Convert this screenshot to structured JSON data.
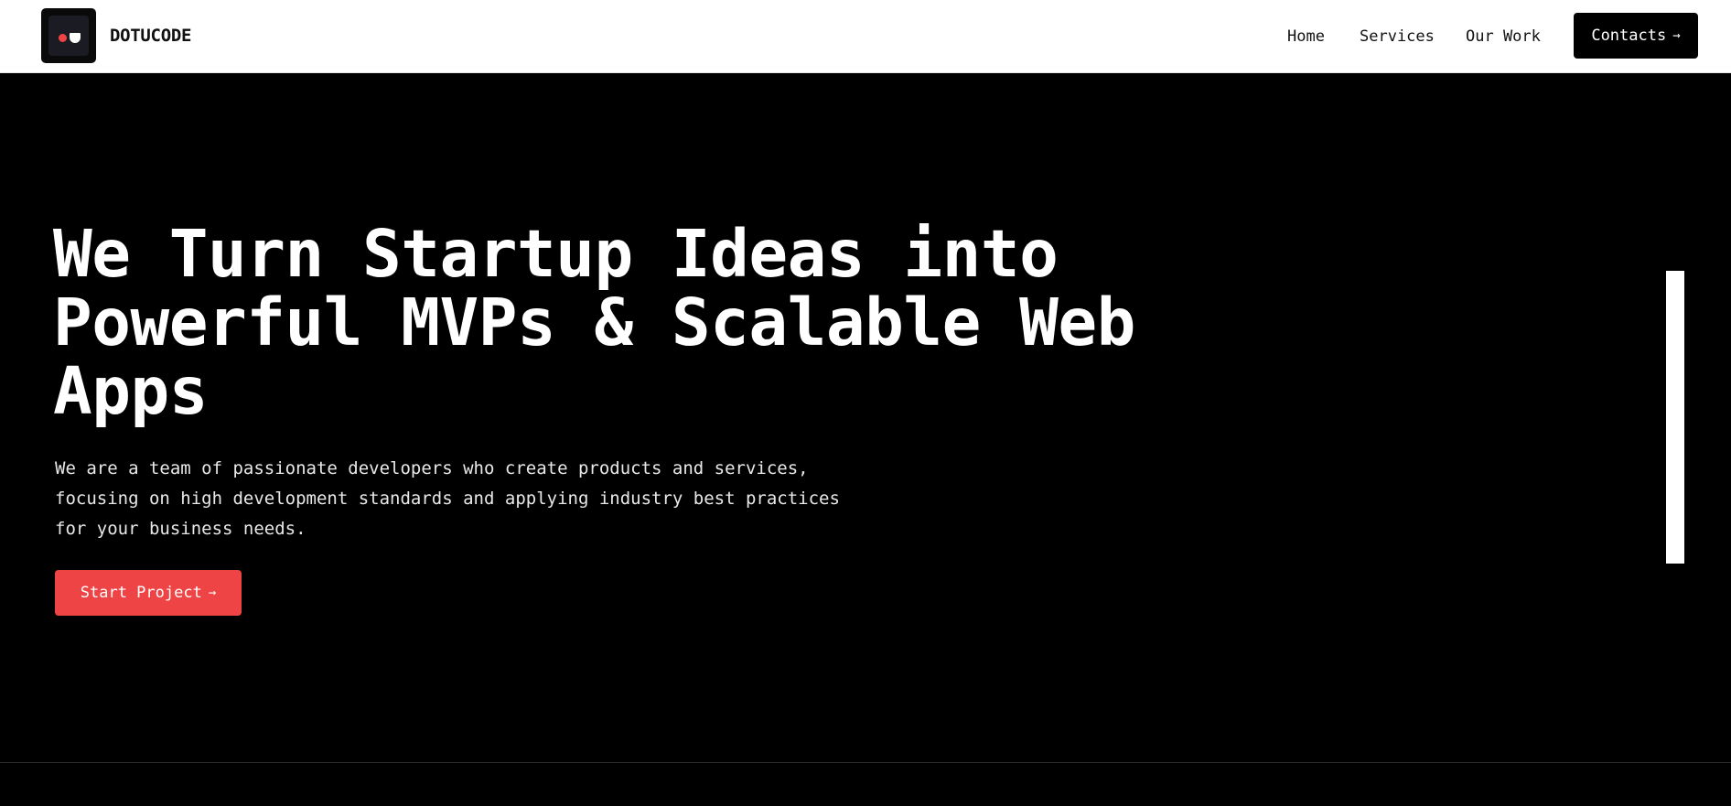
{
  "header": {
    "brand": "DOTUCODE",
    "nav": {
      "home": "Home",
      "services": "Services",
      "our_work": "Our Work"
    },
    "contacts_label": "Contacts",
    "contacts_arrow": "→"
  },
  "hero": {
    "title_lines": [
      "We Turn Startup Ideas into",
      "Powerful MVPs & Scalable Web",
      "Apps"
    ],
    "description_lines": [
      "We are a team of passionate developers who create products and services,",
      "focusing on high development standards and applying industry best practices",
      "for your business needs."
    ],
    "cta_label": "Start Project",
    "cta_arrow": "→"
  },
  "colors": {
    "accent": "#ef4446",
    "background": "#000000",
    "header_bg": "#ffffff",
    "logo_dot": "#ef4446"
  },
  "icons": {
    "logo": "dotucode-logo-icon",
    "arrow": "arrow-right-icon"
  }
}
